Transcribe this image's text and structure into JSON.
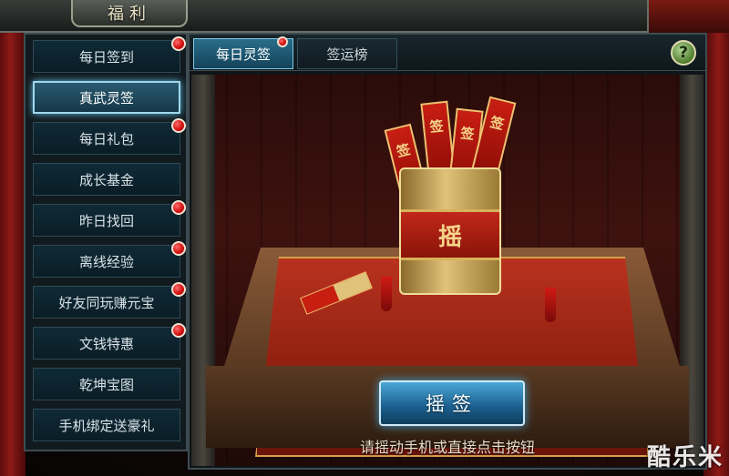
{
  "window": {
    "title": "福利"
  },
  "sidebar": {
    "items": [
      {
        "label": "每日签到",
        "badge": true,
        "active": false
      },
      {
        "label": "真武灵签",
        "badge": false,
        "active": true
      },
      {
        "label": "每日礼包",
        "badge": true,
        "active": false
      },
      {
        "label": "成长基金",
        "badge": false,
        "active": false
      },
      {
        "label": "昨日找回",
        "badge": true,
        "active": false
      },
      {
        "label": "离线经验",
        "badge": true,
        "active": false
      },
      {
        "label": "好友同玩赚元宝",
        "badge": true,
        "active": false
      },
      {
        "label": "文钱特惠",
        "badge": true,
        "active": false
      },
      {
        "label": "乾坤宝图",
        "badge": false,
        "active": false
      },
      {
        "label": "手机绑定送豪礼",
        "badge": false,
        "active": false
      }
    ]
  },
  "main": {
    "tabs": [
      {
        "label": "每日灵签",
        "active": true,
        "badge": true
      },
      {
        "label": "签运榜",
        "active": false,
        "badge": false
      }
    ],
    "help_label": "?",
    "bucket_label": "摇",
    "stick_label": "签",
    "action_button": "摇签",
    "hint": "请摇动手机或直接点击按钮"
  },
  "watermark": "酷乐米",
  "colors": {
    "accent": "#2a6e8a",
    "badge": "#d10c0c",
    "cloth": "#b8321e"
  }
}
